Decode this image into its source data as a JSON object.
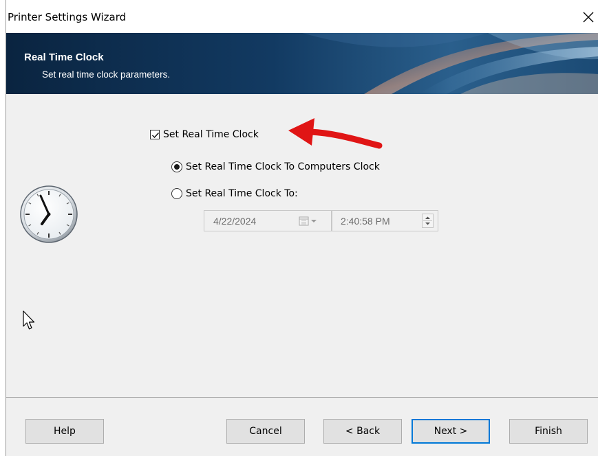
{
  "window": {
    "title": "Printer Settings Wizard",
    "close_icon": "close-icon"
  },
  "banner": {
    "title": "Real Time Clock",
    "subtitle": "Set real time clock parameters."
  },
  "options": {
    "set_clock_label": "Set Real Time Clock",
    "set_clock_checked": true,
    "radio_computer_label": "Set Real Time Clock To Computers Clock",
    "radio_computer_selected": true,
    "radio_custom_label": "Set Real Time Clock To:",
    "radio_custom_selected": false
  },
  "date_field": {
    "value": "4/22/2024",
    "icon": "calendar-dropdown-icon"
  },
  "time_field": {
    "value": "2:40:58 PM",
    "icon": "spinner-icon"
  },
  "buttons": {
    "help": "Help",
    "cancel": "Cancel",
    "back": "< Back",
    "next": "Next >",
    "finish": "Finish"
  },
  "colors": {
    "banner_dark": "#0c2a4a",
    "accent_arrow": "#e01515",
    "default_button_border": "#0078d7",
    "window_bg": "#f0f0f0"
  }
}
